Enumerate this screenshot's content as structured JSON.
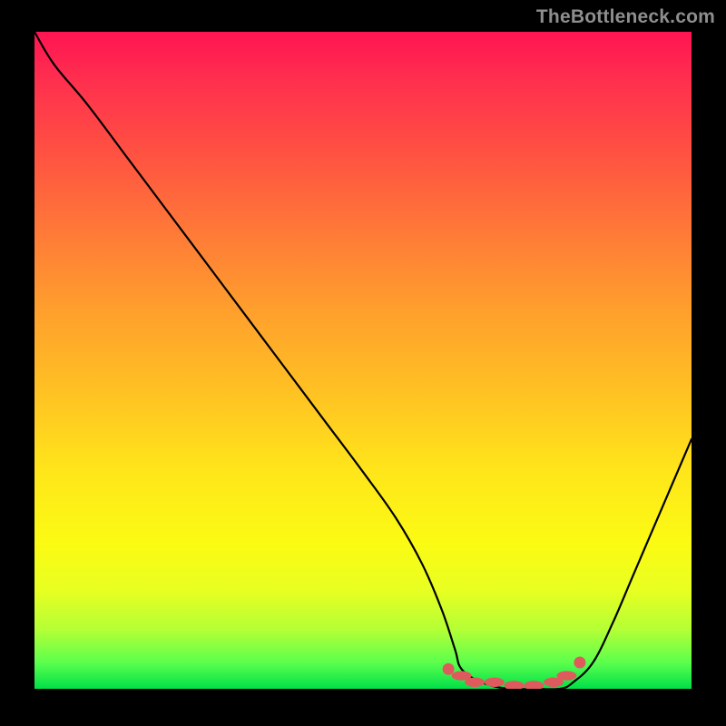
{
  "watermark": "TheBottleneck.com",
  "chart_data": {
    "type": "line",
    "title": "",
    "xlabel": "",
    "ylabel": "",
    "xlim": [
      0,
      100
    ],
    "ylim": [
      0,
      100
    ],
    "background_gradient": {
      "top": "#ff1452",
      "bottom": "#00e048",
      "meaning": "red-high to green-low bottleneck percentage"
    },
    "series": [
      {
        "name": "bottleneck-curve",
        "type": "line",
        "color": "#000000",
        "x": [
          0,
          3,
          8,
          14,
          20,
          26,
          32,
          38,
          44,
          50,
          55,
          59,
          62,
          64,
          65,
          68,
          72,
          76,
          80,
          82,
          85,
          88,
          91,
          94,
          97,
          100
        ],
        "values": [
          100,
          95,
          89,
          81,
          73,
          65,
          57,
          49,
          41,
          33,
          26,
          19,
          12,
          6,
          3,
          1,
          0,
          0,
          0,
          1,
          4,
          10,
          17,
          24,
          31,
          38
        ]
      },
      {
        "name": "optimal-range-markers",
        "type": "scatter",
        "color": "#df5a5d",
        "marker": "round",
        "x": [
          63,
          65,
          67,
          70,
          73,
          76,
          79,
          81,
          83
        ],
        "values": [
          3,
          2,
          1,
          1,
          0.5,
          0.5,
          1,
          2,
          4
        ]
      }
    ]
  }
}
